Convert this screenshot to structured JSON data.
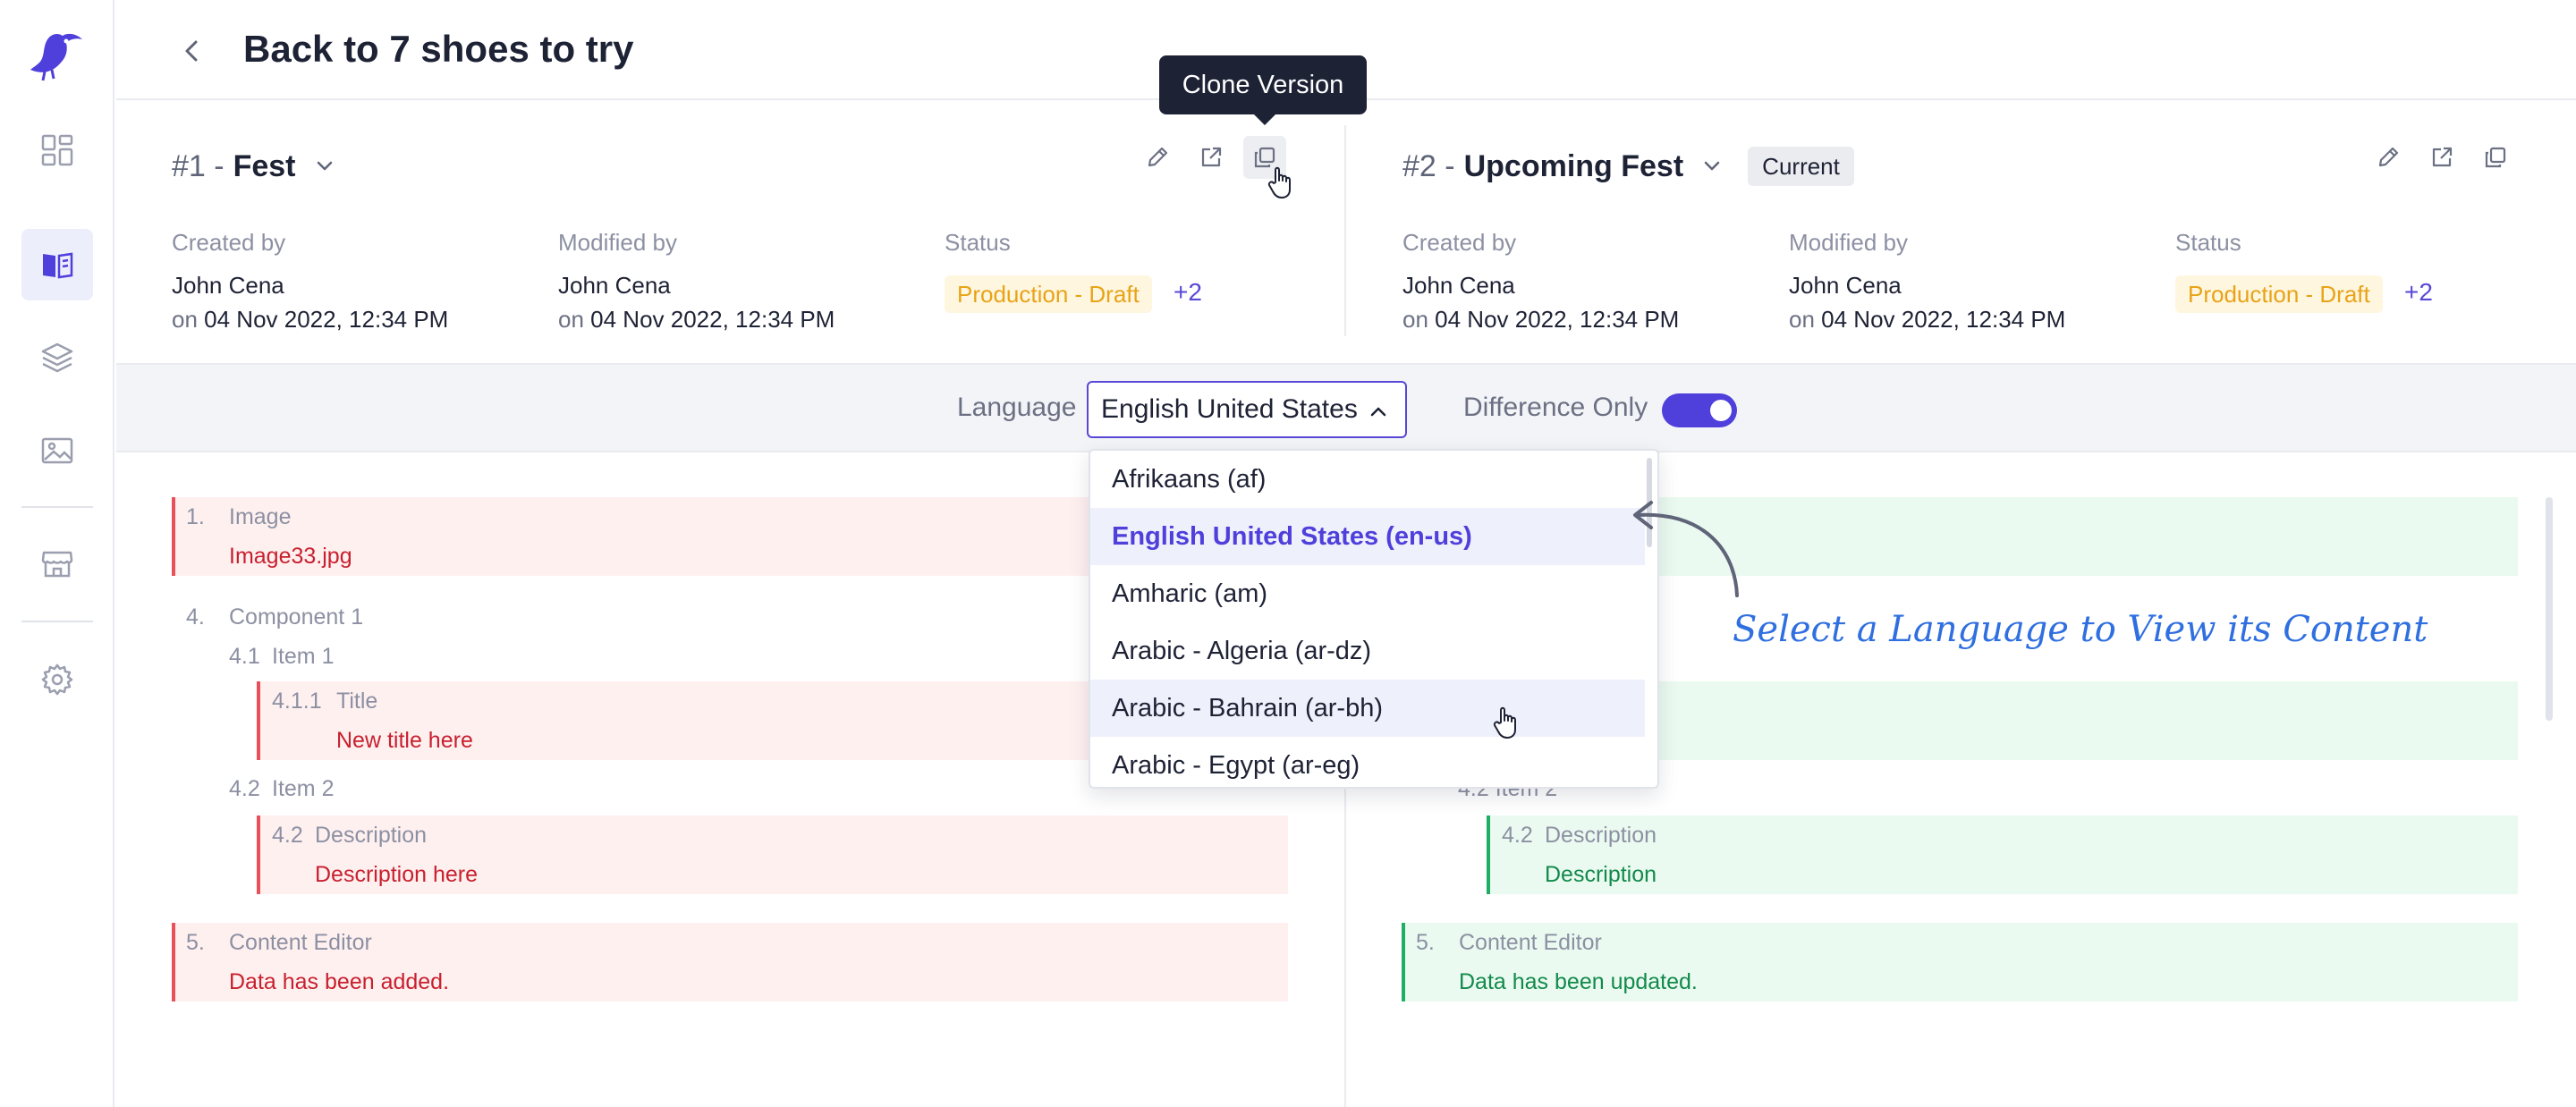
{
  "header": {
    "title": "Back to 7 shoes to try"
  },
  "tooltip": {
    "label": "Clone Version"
  },
  "versions": [
    {
      "number": "#1 -",
      "name": "Fest",
      "badge": "",
      "created_label": "Created by",
      "created_by": "John Cena",
      "created_on_prefix": "on",
      "created_on": "04 Nov 2022, 12:34 PM",
      "modified_label": "Modified by",
      "modified_by": "John Cena",
      "modified_on_prefix": "on",
      "modified_on": "04 Nov 2022, 12:34 PM",
      "status_label": "Status",
      "status": "Production - Draft",
      "status_more": "+2"
    },
    {
      "number": "#2 -",
      "name": "Upcoming Fest",
      "badge": "Current",
      "created_label": "Created by",
      "created_by": "John Cena",
      "created_on_prefix": "on",
      "created_on": "04 Nov 2022, 12:34 PM",
      "modified_label": "Modified by",
      "modified_by": "John Cena",
      "modified_on_prefix": "on",
      "modified_on": "04 Nov 2022, 12:34 PM",
      "status_label": "Status",
      "status": "Production - Draft",
      "status_more": "+2"
    }
  ],
  "toolbar": {
    "language_label": "Language",
    "language_value": "English United States",
    "difference_label": "Difference Only",
    "difference_on": true
  },
  "dropdown": {
    "options": [
      "Afrikaans (af)",
      "English United States (en-us)",
      "Amharic (am)",
      "Arabic - Algeria (ar-dz)",
      "Arabic - Bahrain (ar-bh)",
      "Arabic - Egypt (ar-eg)"
    ],
    "selected_index": 1,
    "hover_index": 4
  },
  "annotation": {
    "text": "Select a Language to View its Content"
  },
  "diff_left": {
    "image_num": "1.",
    "image_label": "Image",
    "image_value": "Image33.jpg",
    "component_num": "4.",
    "component_label": "Component 1",
    "item1_num": "4.1",
    "item1_label": "Item 1",
    "title_num": "4.1.1",
    "title_label": "Title",
    "title_value": "New title here",
    "item2_num": "4.2",
    "item2_label": "Item 2",
    "desc_num": "4.2",
    "desc_label": "Description",
    "desc_value": "Description here",
    "editor_num": "5.",
    "editor_label": "Content Editor",
    "editor_value": "Data has been added."
  },
  "diff_right": {
    "item2_partial": "4.2 Item 2",
    "desc_num": "4.2",
    "desc_label": "Description",
    "desc_value": "Description",
    "editor_num": "5.",
    "editor_label": "Content Editor",
    "editor_value": "Data has been updated."
  },
  "colors": {
    "accent": "#5848d6",
    "deleted": "#e8515a",
    "added": "#1fae63",
    "status": "#e8a317"
  }
}
